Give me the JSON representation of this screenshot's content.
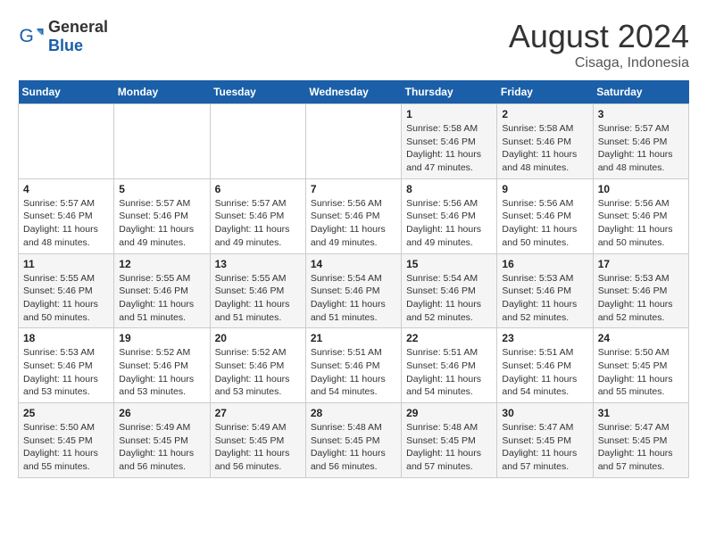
{
  "header": {
    "logo_general": "General",
    "logo_blue": "Blue",
    "month_year": "August 2024",
    "location": "Cisaga, Indonesia"
  },
  "calendar": {
    "days_of_week": [
      "Sunday",
      "Monday",
      "Tuesday",
      "Wednesday",
      "Thursday",
      "Friday",
      "Saturday"
    ],
    "weeks": [
      [
        {
          "day": "",
          "info": ""
        },
        {
          "day": "",
          "info": ""
        },
        {
          "day": "",
          "info": ""
        },
        {
          "day": "",
          "info": ""
        },
        {
          "day": "1",
          "info": "Sunrise: 5:58 AM\nSunset: 5:46 PM\nDaylight: 11 hours and 47 minutes."
        },
        {
          "day": "2",
          "info": "Sunrise: 5:58 AM\nSunset: 5:46 PM\nDaylight: 11 hours and 48 minutes."
        },
        {
          "day": "3",
          "info": "Sunrise: 5:57 AM\nSunset: 5:46 PM\nDaylight: 11 hours and 48 minutes."
        }
      ],
      [
        {
          "day": "4",
          "info": "Sunrise: 5:57 AM\nSunset: 5:46 PM\nDaylight: 11 hours and 48 minutes."
        },
        {
          "day": "5",
          "info": "Sunrise: 5:57 AM\nSunset: 5:46 PM\nDaylight: 11 hours and 49 minutes."
        },
        {
          "day": "6",
          "info": "Sunrise: 5:57 AM\nSunset: 5:46 PM\nDaylight: 11 hours and 49 minutes."
        },
        {
          "day": "7",
          "info": "Sunrise: 5:56 AM\nSunset: 5:46 PM\nDaylight: 11 hours and 49 minutes."
        },
        {
          "day": "8",
          "info": "Sunrise: 5:56 AM\nSunset: 5:46 PM\nDaylight: 11 hours and 49 minutes."
        },
        {
          "day": "9",
          "info": "Sunrise: 5:56 AM\nSunset: 5:46 PM\nDaylight: 11 hours and 50 minutes."
        },
        {
          "day": "10",
          "info": "Sunrise: 5:56 AM\nSunset: 5:46 PM\nDaylight: 11 hours and 50 minutes."
        }
      ],
      [
        {
          "day": "11",
          "info": "Sunrise: 5:55 AM\nSunset: 5:46 PM\nDaylight: 11 hours and 50 minutes."
        },
        {
          "day": "12",
          "info": "Sunrise: 5:55 AM\nSunset: 5:46 PM\nDaylight: 11 hours and 51 minutes."
        },
        {
          "day": "13",
          "info": "Sunrise: 5:55 AM\nSunset: 5:46 PM\nDaylight: 11 hours and 51 minutes."
        },
        {
          "day": "14",
          "info": "Sunrise: 5:54 AM\nSunset: 5:46 PM\nDaylight: 11 hours and 51 minutes."
        },
        {
          "day": "15",
          "info": "Sunrise: 5:54 AM\nSunset: 5:46 PM\nDaylight: 11 hours and 52 minutes."
        },
        {
          "day": "16",
          "info": "Sunrise: 5:53 AM\nSunset: 5:46 PM\nDaylight: 11 hours and 52 minutes."
        },
        {
          "day": "17",
          "info": "Sunrise: 5:53 AM\nSunset: 5:46 PM\nDaylight: 11 hours and 52 minutes."
        }
      ],
      [
        {
          "day": "18",
          "info": "Sunrise: 5:53 AM\nSunset: 5:46 PM\nDaylight: 11 hours and 53 minutes."
        },
        {
          "day": "19",
          "info": "Sunrise: 5:52 AM\nSunset: 5:46 PM\nDaylight: 11 hours and 53 minutes."
        },
        {
          "day": "20",
          "info": "Sunrise: 5:52 AM\nSunset: 5:46 PM\nDaylight: 11 hours and 53 minutes."
        },
        {
          "day": "21",
          "info": "Sunrise: 5:51 AM\nSunset: 5:46 PM\nDaylight: 11 hours and 54 minutes."
        },
        {
          "day": "22",
          "info": "Sunrise: 5:51 AM\nSunset: 5:46 PM\nDaylight: 11 hours and 54 minutes."
        },
        {
          "day": "23",
          "info": "Sunrise: 5:51 AM\nSunset: 5:46 PM\nDaylight: 11 hours and 54 minutes."
        },
        {
          "day": "24",
          "info": "Sunrise: 5:50 AM\nSunset: 5:45 PM\nDaylight: 11 hours and 55 minutes."
        }
      ],
      [
        {
          "day": "25",
          "info": "Sunrise: 5:50 AM\nSunset: 5:45 PM\nDaylight: 11 hours and 55 minutes."
        },
        {
          "day": "26",
          "info": "Sunrise: 5:49 AM\nSunset: 5:45 PM\nDaylight: 11 hours and 56 minutes."
        },
        {
          "day": "27",
          "info": "Sunrise: 5:49 AM\nSunset: 5:45 PM\nDaylight: 11 hours and 56 minutes."
        },
        {
          "day": "28",
          "info": "Sunrise: 5:48 AM\nSunset: 5:45 PM\nDaylight: 11 hours and 56 minutes."
        },
        {
          "day": "29",
          "info": "Sunrise: 5:48 AM\nSunset: 5:45 PM\nDaylight: 11 hours and 57 minutes."
        },
        {
          "day": "30",
          "info": "Sunrise: 5:47 AM\nSunset: 5:45 PM\nDaylight: 11 hours and 57 minutes."
        },
        {
          "day": "31",
          "info": "Sunrise: 5:47 AM\nSunset: 5:45 PM\nDaylight: 11 hours and 57 minutes."
        }
      ]
    ]
  }
}
